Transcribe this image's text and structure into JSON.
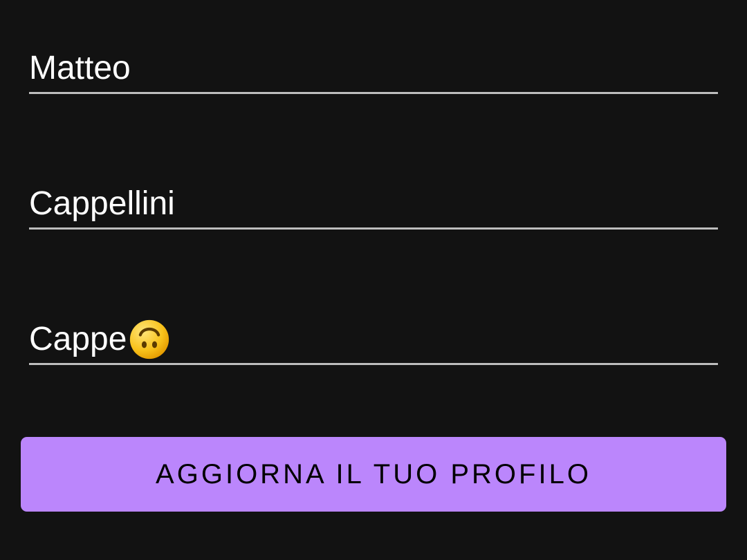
{
  "form": {
    "first_name": {
      "value": "Matteo"
    },
    "last_name": {
      "value": "Cappellini"
    },
    "nickname": {
      "value": "Cappe",
      "emoji": "upside-down-face-icon"
    }
  },
  "actions": {
    "update_profile_label": "AGGIORNA IL TUO PROFILO"
  },
  "colors": {
    "background": "#121212",
    "underline": "#bdbdbd",
    "text": "#ffffff",
    "button_background": "#bb86fc",
    "button_text": "#000000"
  }
}
